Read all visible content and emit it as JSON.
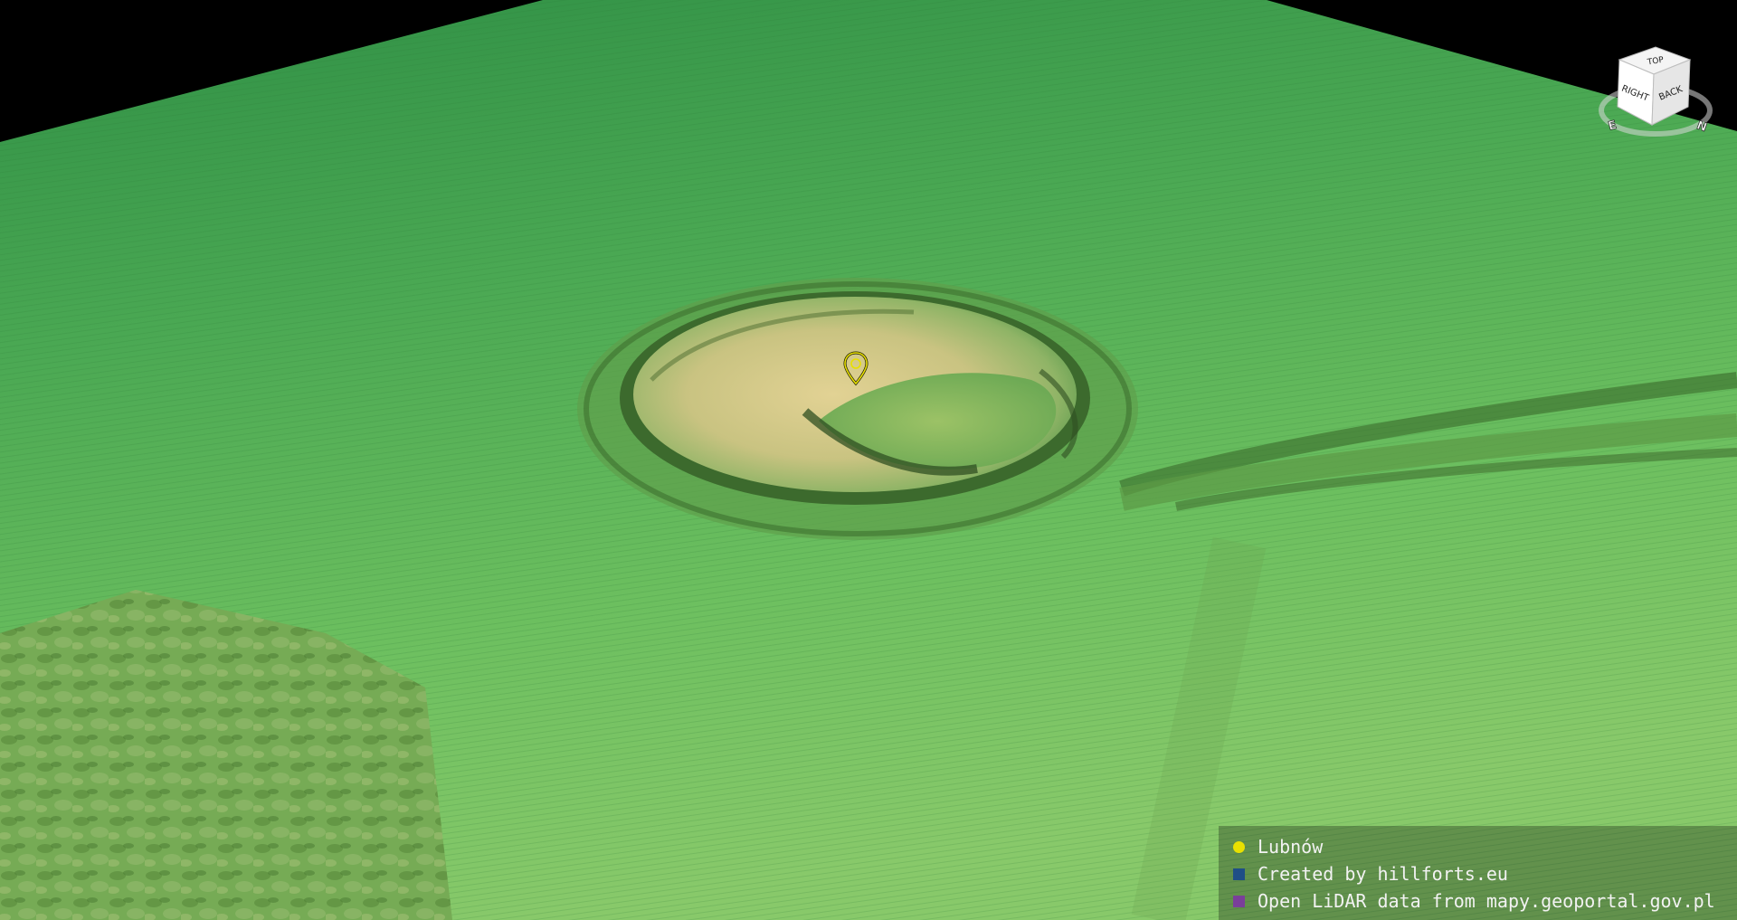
{
  "map": {
    "colors": {
      "background": "#000000",
      "terrain_low": "#3f9e4c",
      "terrain_mid": "#6bbf5f",
      "terrain_high": "#d8c98a",
      "ridge_shadow": "#2c4a22",
      "marker": "#e8e000"
    }
  },
  "nav_cube": {
    "face_top": "TOP",
    "face_right": "RIGHT",
    "face_back": "BACK",
    "compass_east": "E",
    "compass_north": "N",
    "icon": "navigation-cube-icon"
  },
  "marker": {
    "icon": "map-pin-icon",
    "color": "#e8e000"
  },
  "legend": {
    "items": [
      {
        "label": "Lubnów",
        "color": "#e8e000",
        "shape": "circle"
      },
      {
        "label": "Created by hillforts.eu",
        "color": "#1f4f86",
        "shape": "square"
      },
      {
        "label": "Open LiDAR data from mapy.geoportal.gov.pl",
        "color": "#7a3f9a",
        "shape": "square"
      }
    ]
  }
}
